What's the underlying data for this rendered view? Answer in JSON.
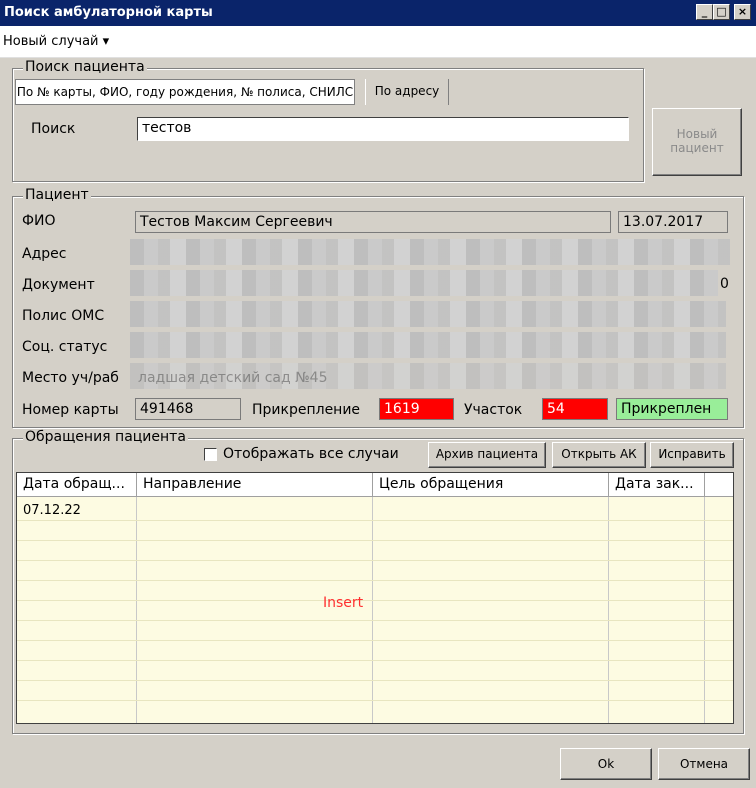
{
  "window": {
    "title": "Поиск амбулаторной карты",
    "controls": {
      "minimize": "_",
      "maximize": "□",
      "close": "×"
    }
  },
  "menu": {
    "new_case": "Новый случай ▾"
  },
  "search": {
    "group_title": "Поиск пациента",
    "tabs": [
      "По № карты, ФИО, году рождения, № полиса, СНИЛС",
      "По адресу"
    ],
    "label": "Поиск",
    "value": "тестов",
    "new_patient_button": "Новый пациент"
  },
  "patient": {
    "group_title": "Пациент",
    "labels": {
      "fio": "ФИО",
      "address": "Адрес",
      "document": "Документ",
      "policy": "Полис ОМС",
      "social": "Соц. статус",
      "workplace": "Место уч/раб",
      "card_number": "Номер карты",
      "attachment": "Прикрепление",
      "district": "Участок"
    },
    "fio": "Тестов Максим Сергеевич",
    "birth_date": "13.07.2017",
    "document_suffix": "0",
    "workplace_partial": "ладшая детский сад №45",
    "card_number": "491468",
    "attachment": "1619",
    "district": "54",
    "attachment_status": "Прикреплен",
    "colors": {
      "alert": "#ff0000",
      "ok": "#99ee99"
    }
  },
  "visits": {
    "group_title": "Обращения пациента",
    "show_all_label": "Отображать все случаи",
    "show_all_checked": false,
    "buttons": [
      "Архив пациента",
      "Открыть АК",
      "Исправить"
    ],
    "columns": [
      "Дата обращ...",
      "Направление",
      "Цель обращения",
      "Дата зак..."
    ],
    "rows": [
      [
        "07.12.22",
        "",
        "",
        ""
      ]
    ],
    "overlay_text": "Insert"
  },
  "footer": {
    "ok": "Ok",
    "cancel": "Отмена"
  }
}
